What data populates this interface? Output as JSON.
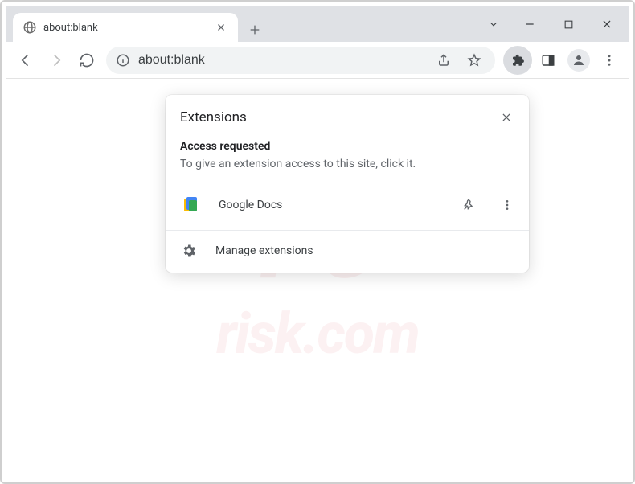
{
  "tab": {
    "title": "about:blank"
  },
  "address": {
    "url": "about:blank"
  },
  "popup": {
    "title": "Extensions",
    "access_heading": "Access requested",
    "access_desc": "To give an extension access to this site, click it.",
    "items": [
      {
        "name": "Google Docs"
      }
    ],
    "manage_label": "Manage extensions"
  },
  "watermark": {
    "line1": "PC",
    "line2": "risk.com"
  }
}
